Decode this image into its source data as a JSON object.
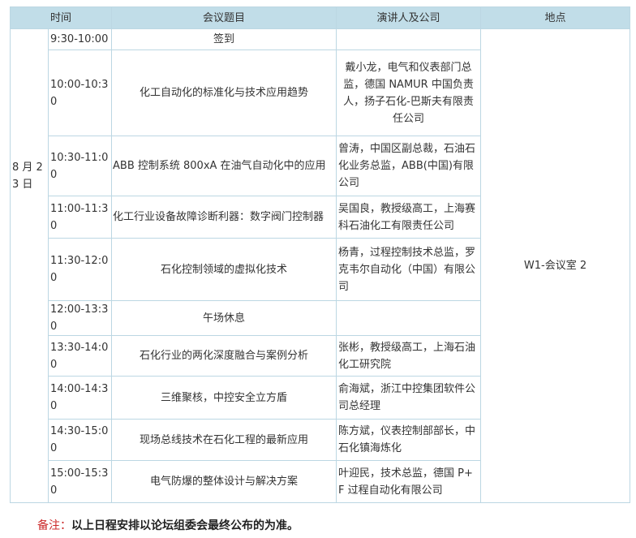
{
  "headers": {
    "time": "时间",
    "topic": "会议题目",
    "speaker": "演讲人及公司",
    "venue": "地点"
  },
  "date": "8 月 23 日",
  "venue": "W1-会议室 2",
  "rows": [
    {
      "time": "9:30-10:00",
      "topic": "签到",
      "speaker": ""
    },
    {
      "time": "10:00-10:30",
      "topic": "化工自动化的标准化与技术应用趋势",
      "speaker": "戴小龙，电气和仪表部门总监，德国 NAMUR 中国负责人，扬子石化-巴斯夫有限责任公司"
    },
    {
      "time": "10:30-11:00",
      "topic": "ABB 控制系统 800xA 在油气自动化中的应用",
      "speaker": "曾涛，中国区副总裁，石油石化业务总监，ABB(中国)有限公司"
    },
    {
      "time": "11:00-11:30",
      "topic": "化工行业设备故障诊断利器：数字阀门控制器",
      "speaker": "吴国良，教授级高工，上海赛科石油化工有限责任公司"
    },
    {
      "time": "11:30-12:00",
      "topic": "石化控制领域的虚拟化技术",
      "speaker": "杨青，过程控制技术总监，罗克韦尔自动化（中国）有限公司"
    },
    {
      "time": "12:00-13:30",
      "topic": "午场休息",
      "speaker": ""
    },
    {
      "time": "13:30-14:00",
      "topic": "石化行业的两化深度融合与案例分析",
      "speaker": "张彬，教授级高工，上海石油化工研究院"
    },
    {
      "time": "14:00-14:30",
      "topic": "三维聚核，中控安全立方盾",
      "speaker": "俞海斌，浙江中控集团软件公司总经理"
    },
    {
      "time": "14:30-15:00",
      "topic": "现场总线技术在石化工程的最新应用",
      "speaker": "陈方斌，仪表控制部部长，中石化镇海炼化"
    },
    {
      "time": "15:00-15:30",
      "topic": "电气防爆的整体设计与解决方案",
      "speaker": "叶迎民，技术总监，德国 P+F 过程自动化有限公司"
    }
  ],
  "note": {
    "label": "备注：",
    "text": "以上日程安排以论坛组委会最终公布的为准。"
  }
}
